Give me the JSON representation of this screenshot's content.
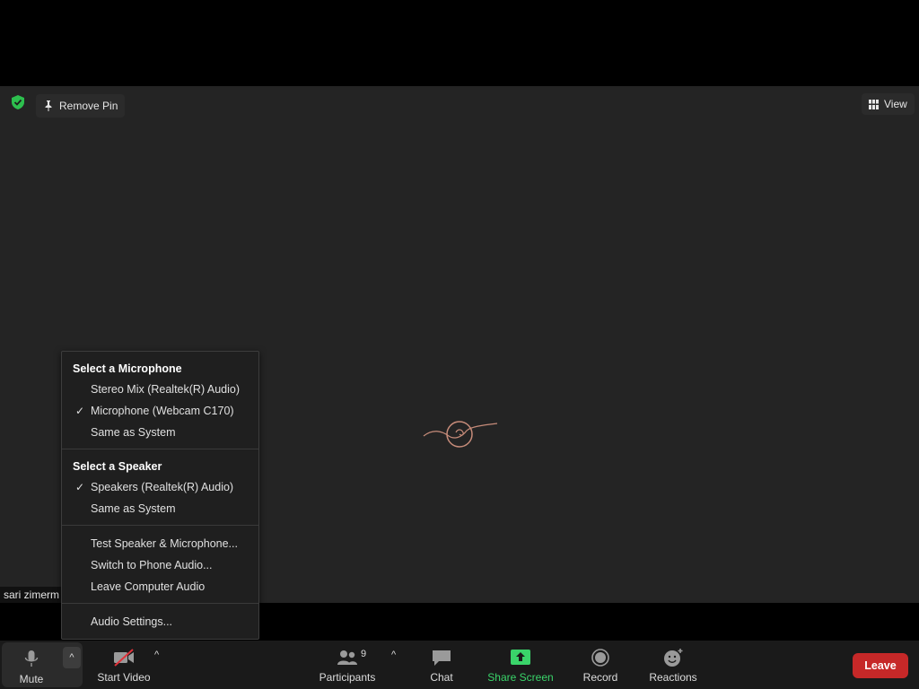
{
  "meeting": {
    "remove_pin_label": "Remove Pin",
    "view_label": "View",
    "participant_name": "sari zimerm",
    "security_color": "#2dbf4e"
  },
  "audio_menu": {
    "microphone_heading": "Select a Microphone",
    "microphones": [
      {
        "label": "Stereo Mix (Realtek(R) Audio)",
        "selected": false
      },
      {
        "label": "Microphone (Webcam C170)",
        "selected": true
      },
      {
        "label": "Same as System",
        "selected": false
      }
    ],
    "speaker_heading": "Select a Speaker",
    "speakers": [
      {
        "label": "Speakers (Realtek(R) Audio)",
        "selected": true
      },
      {
        "label": "Same as System",
        "selected": false
      }
    ],
    "actions": [
      {
        "label": "Test Speaker & Microphone..."
      },
      {
        "label": "Switch to Phone Audio..."
      },
      {
        "label": "Leave Computer Audio"
      }
    ],
    "settings_label": "Audio Settings...",
    "check_glyph": "✓"
  },
  "toolbar": {
    "mute_label": "Mute",
    "start_video_label": "Start Video",
    "participants_label": "Participants",
    "participants_count": "9",
    "chat_label": "Chat",
    "share_screen_label": "Share Screen",
    "record_label": "Record",
    "reactions_label": "Reactions",
    "leave_label": "Leave",
    "caret_glyph": "^",
    "share_color": "#3ad46a",
    "leave_color": "#c62828"
  }
}
